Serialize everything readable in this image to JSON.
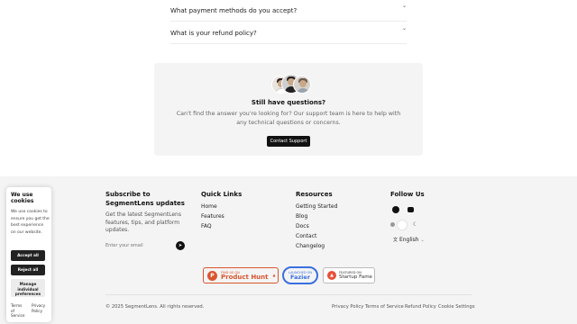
{
  "faq": {
    "items": [
      {
        "question": "What payment methods do you accept?"
      },
      {
        "question": "What is your refund policy?"
      }
    ]
  },
  "help": {
    "title": "Still have questions?",
    "text": "Can't find the answer you're looking for? Our support team is here to help with any technical questions or concerns.",
    "button": "Contact Support"
  },
  "footer": {
    "subscribe": {
      "title": "Subscribe to SegmentLens updates",
      "description": "Get the latest SegmentLens features, tips, and platform updates.",
      "placeholder": "Enter your email"
    },
    "quick_links": {
      "heading": "Quick Links",
      "items": [
        "Home",
        "Features",
        "FAQ"
      ]
    },
    "resources": {
      "heading": "Resources",
      "items": [
        "Getting Started",
        "Blog",
        "Docs",
        "Contact",
        "Changelog"
      ]
    },
    "follow": {
      "heading": "Follow Us",
      "icons": [
        "github-icon",
        "discord-icon"
      ],
      "language": "English"
    },
    "badges": {
      "product_hunt": {
        "small": "FIND US ON",
        "big": "Product Hunt",
        "upvote": "▲"
      },
      "fazier": {
        "small": "LAUNCHED ON",
        "big": "Fazier"
      },
      "startup_fame": {
        "small": "FEATURED ON",
        "big": "Startup Fame"
      }
    },
    "copyright": "© 2025 SegmentLens. All rights reserved.",
    "bottom_links": [
      "Privacy Policy",
      "Terms of Service",
      "Refund Policy",
      "Cookie Settings"
    ]
  },
  "cookie": {
    "title": "We use cookies",
    "text": "We use cookies to ensure you get the best experience on our website.",
    "accept": "Accept all",
    "reject": "Reject all",
    "manage": "Manage individual preferences",
    "terms": "Terms of Service",
    "privacy": "Privacy Policy"
  },
  "colors": {
    "accent_dark": "#111111",
    "product_hunt": "#da552f",
    "fazier": "#3b6fe0"
  }
}
